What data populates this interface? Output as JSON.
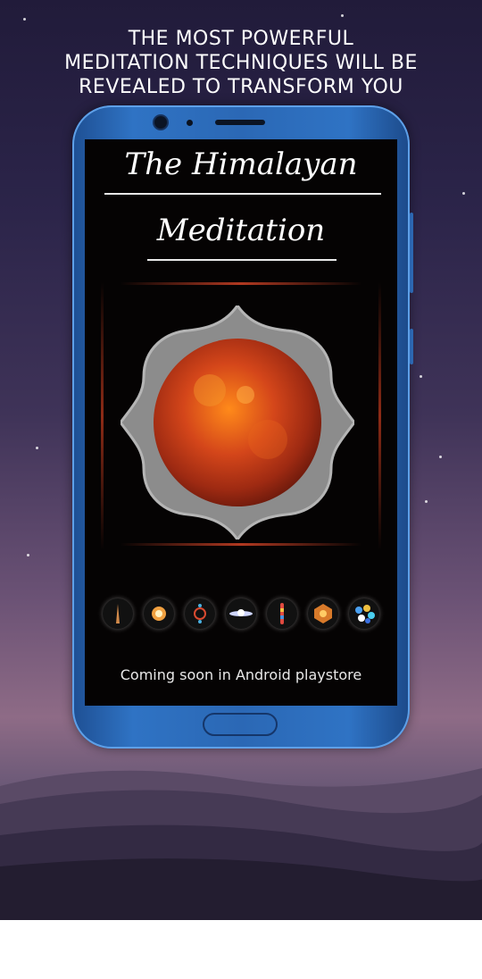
{
  "headline": {
    "lines": [
      "THE MOST POWERFUL",
      "MEDITATION TECHNIQUES WILL BE",
      "REVEALED TO TRANSFORM YOU"
    ]
  },
  "app": {
    "title_line1": "The Himalayan",
    "title_line2": "Meditation",
    "footer": "Coming soon in Android playstore",
    "icons": [
      "root-chakra-icon",
      "sacral-chakra-icon",
      "solar-plexus-chakra-icon",
      "heart-chakra-icon",
      "throat-chakra-icon",
      "third-eye-chakra-icon",
      "crown-chakra-icon"
    ]
  },
  "colors": {
    "phone_body": "#2b68b5",
    "sun": "#c23a10",
    "screen": "#050303"
  }
}
